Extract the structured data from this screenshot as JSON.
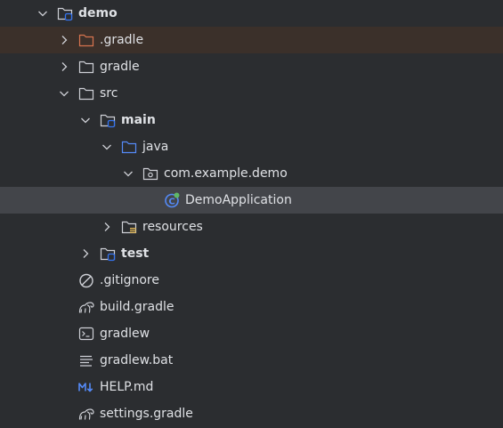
{
  "tree": {
    "root_label": "demo",
    "gradle_dot_label": ".gradle",
    "gradle_label": "gradle",
    "src_label": "src",
    "main_label": "main",
    "java_label": "java",
    "package_label": "com.example.demo",
    "app_class_label": "DemoApplication",
    "resources_label": "resources",
    "test_label": "test",
    "gitignore_label": ".gitignore",
    "build_gradle_label": "build.gradle",
    "gradlew_label": "gradlew",
    "gradlew_bat_label": "gradlew.bat",
    "help_md_label": "HELP.md",
    "settings_gradle_label": "settings.gradle"
  },
  "colors": {
    "background": "#2b2d30",
    "selected_row": "#43454a",
    "excluded_row": "#3b302a",
    "excluded_folder": "#d7744f",
    "source_folder": "#548af7",
    "module_badge": "#3574f0",
    "text": "#dfe1e5"
  },
  "icons": {
    "expanded": "chevron-down-icon",
    "collapsed": "chevron-right-icon",
    "module": "module-folder-icon",
    "folder": "folder-icon",
    "source_root": "source-folder-icon",
    "package": "package-icon",
    "spring_class": "spring-boot-class-icon",
    "resources": "resources-folder-icon",
    "ignore": "gitignore-icon",
    "gradle": "gradle-elephant-icon",
    "terminal": "shell-script-icon",
    "text": "text-file-icon",
    "markdown": "markdown-icon"
  }
}
